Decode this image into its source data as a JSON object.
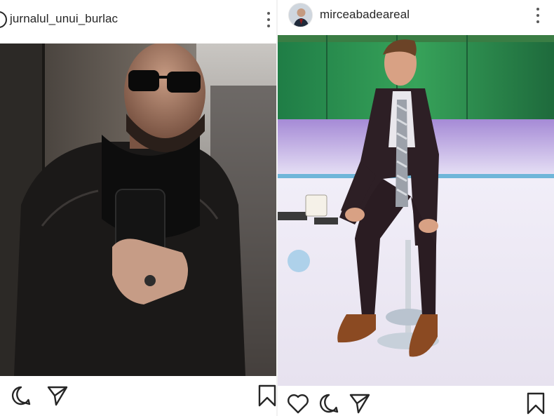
{
  "posts": [
    {
      "username": "jurnalul_unui_burlac",
      "header_icons": {
        "more": "more-vertical-icon"
      },
      "actions": [
        "comment-icon",
        "share-icon",
        "bookmark-icon"
      ]
    },
    {
      "username": "mirceabadeareal",
      "header_icons": {
        "more": "more-vertical-icon"
      },
      "actions": [
        "like-icon",
        "comment-icon",
        "share-icon",
        "bookmark-icon"
      ]
    }
  ],
  "colors": {
    "text": "#262626",
    "icon": "#262626",
    "background": "#ffffff",
    "studio_green": "#2f8f4a",
    "studio_blue": "#6fb6d9"
  }
}
